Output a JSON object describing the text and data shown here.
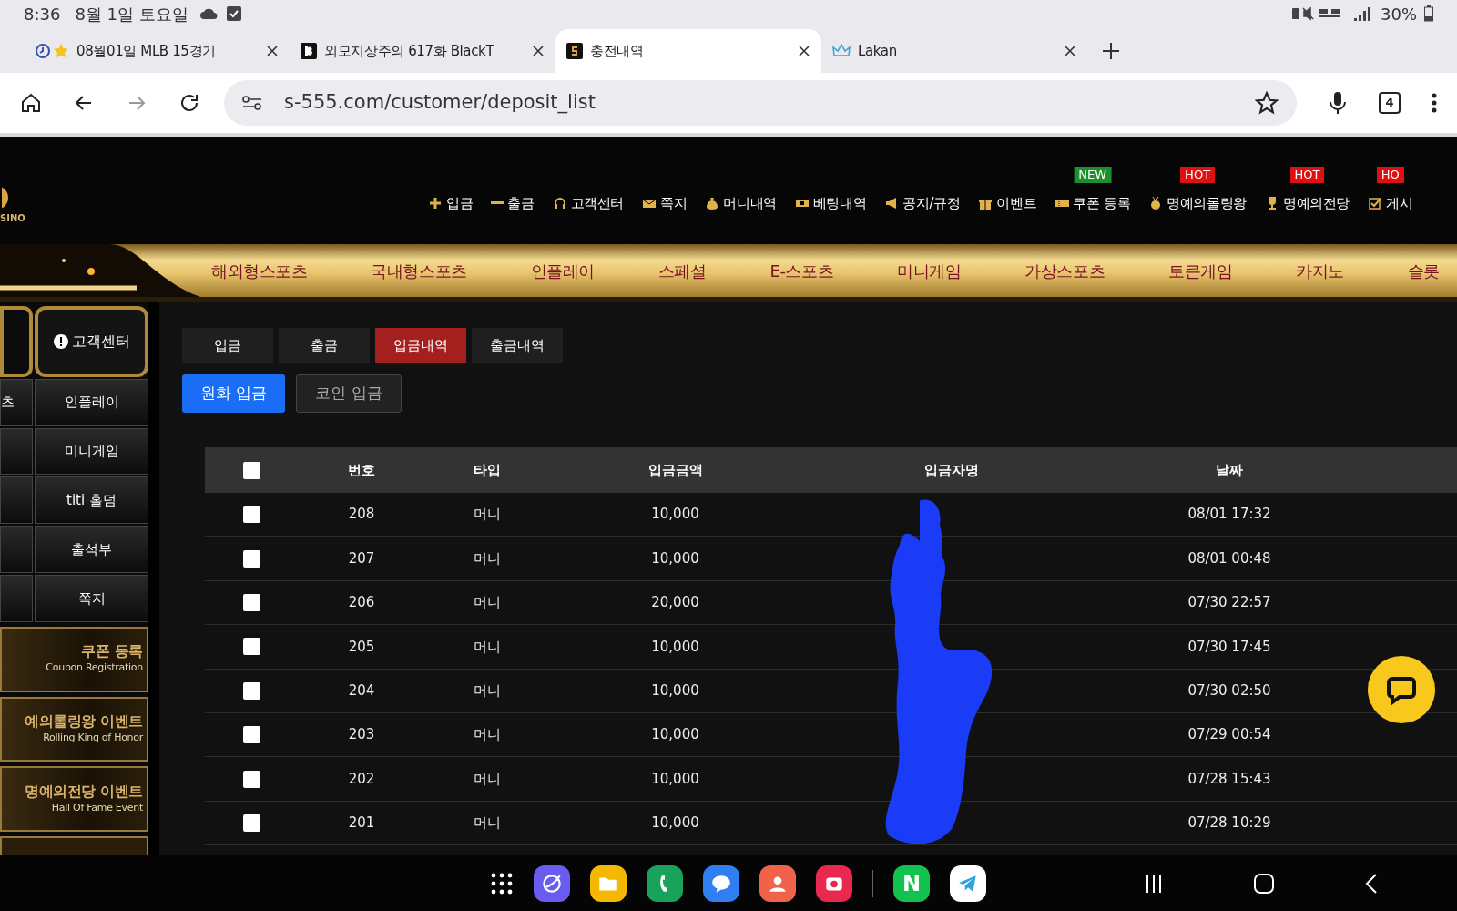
{
  "status_bar": {
    "time": "8:36",
    "date": "8월 1일 토요일",
    "battery": "30%"
  },
  "browser_tabs": [
    {
      "title": "08월01일 MLB 15경기",
      "selected": false
    },
    {
      "title": "외모지상주의 617화 BlackT",
      "selected": false
    },
    {
      "title": "충전내역",
      "selected": true
    },
    {
      "title": "Lakan",
      "selected": false
    }
  ],
  "address_bar": {
    "url": "s-555.com/customer/deposit_list",
    "tab_count": "4"
  },
  "site_logo": {
    "text": "SINO"
  },
  "top_menu": [
    {
      "label": "입금"
    },
    {
      "label": "출금"
    },
    {
      "label": "고객센터"
    },
    {
      "label": "쪽지"
    },
    {
      "label": "머니내역"
    },
    {
      "label": "베팅내역"
    },
    {
      "label": "공지/규정"
    },
    {
      "label": "이벤트"
    },
    {
      "label": "쿠폰 등록",
      "badge": "NEW",
      "color": "#1e8e2e"
    },
    {
      "label": "명예의롤링왕",
      "badge": "HOT",
      "color": "#e01010"
    },
    {
      "label": "명예의전당",
      "badge": "HOT",
      "color": "#e01010"
    },
    {
      "label": "게시",
      "badge": "HO",
      "color": "#e01010"
    }
  ],
  "game_nav": [
    "해외형스포츠",
    "국내형스포츠",
    "인플레이",
    "스페셜",
    "E-스포츠",
    "미니게임",
    "가상스포츠",
    "토큰게임",
    "카지노",
    "슬롯"
  ],
  "sidebar": {
    "support_button": "고객센터",
    "tiles": [
      {
        "left": "츠",
        "right": "인플레이"
      },
      {
        "right": "미니게임"
      },
      {
        "right": "titi 홀덤"
      },
      {
        "right": "출석부"
      },
      {
        "right": "쪽지"
      }
    ],
    "banners": [
      {
        "title": "쿠폰 등록",
        "subtitle": "Coupon Registration"
      },
      {
        "title": "예의롤링왕 이벤트",
        "subtitle": "Rolling King of Honor"
      },
      {
        "title": "명예의전당 이벤트",
        "subtitle": "Hall Of Fame Event"
      }
    ]
  },
  "sub_tabs": [
    {
      "label": "입금",
      "selected": false
    },
    {
      "label": "출금",
      "selected": false
    },
    {
      "label": "입금내역",
      "selected": true
    },
    {
      "label": "출금내역",
      "selected": false
    }
  ],
  "deposit_types": [
    {
      "label": "원화 입금",
      "selected": true
    },
    {
      "label": "코인 입금",
      "selected": false
    }
  ],
  "table": {
    "columns": [
      "번호",
      "타입",
      "입금금액",
      "입금자명",
      "날짜"
    ],
    "all_checked": false,
    "rows": [
      {
        "checked": false,
        "number": "208",
        "type": "머니",
        "amount": "10,000",
        "date": "08/01 17:32"
      },
      {
        "checked": false,
        "number": "207",
        "type": "머니",
        "amount": "10,000",
        "date": "08/01 00:48"
      },
      {
        "checked": false,
        "number": "206",
        "type": "머니",
        "amount": "20,000",
        "date": "07/30 22:57"
      },
      {
        "checked": false,
        "number": "205",
        "type": "머니",
        "amount": "10,000",
        "date": "07/30 17:45"
      },
      {
        "checked": false,
        "number": "204",
        "type": "머니",
        "amount": "10,000",
        "date": "07/30 02:50"
      },
      {
        "checked": false,
        "number": "203",
        "type": "머니",
        "amount": "10,000",
        "date": "07/29 00:54"
      },
      {
        "checked": false,
        "number": "202",
        "type": "머니",
        "amount": "10,000",
        "date": "07/28 15:43"
      },
      {
        "checked": false,
        "number": "201",
        "type": "머니",
        "amount": "10,000",
        "date": "07/28 10:29"
      }
    ]
  },
  "dock": [
    {
      "kind": "grid"
    },
    {
      "kind": "browser",
      "color": "#6a5cf0"
    },
    {
      "kind": "folder",
      "color": "#f5b800"
    },
    {
      "kind": "phone",
      "color": "#19a35a"
    },
    {
      "kind": "messages",
      "color": "#2f7ff0"
    },
    {
      "kind": "contacts",
      "color": "#f0634a"
    },
    {
      "kind": "camera",
      "color": "#e8284f"
    },
    {
      "kind": "divider"
    },
    {
      "kind": "letter",
      "color": "#12c24e",
      "label": "N"
    },
    {
      "kind": "telegram",
      "color": "#ffffff"
    }
  ]
}
